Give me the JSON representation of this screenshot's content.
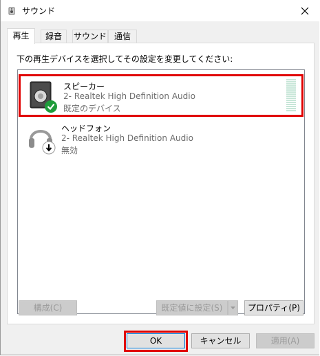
{
  "window": {
    "title": "サウンド"
  },
  "tabs": [
    {
      "label": "再生",
      "active": true
    },
    {
      "label": "録音",
      "active": false
    },
    {
      "label": "サウンド",
      "active": false
    },
    {
      "label": "通信",
      "active": false
    }
  ],
  "playback": {
    "instruction": "下の再生デバイスを選択してその設定を変更してください:",
    "devices": [
      {
        "name": "スピーカー",
        "driver": "2- Realtek High Definition Audio",
        "status": "既定のデバイス",
        "icon": "speaker-icon",
        "badge": "checkmark-icon"
      },
      {
        "name": "ヘッドフォン",
        "driver": "2- Realtek High Definition Audio",
        "status": "無効",
        "icon": "headphones-icon",
        "badge": "down-arrow-icon"
      }
    ]
  },
  "panel_buttons": {
    "configure": "構成(C)",
    "set_default": "既定値に設定(S)",
    "properties": "プロパティ(P)"
  },
  "dialog_buttons": {
    "ok": "OK",
    "cancel": "キャンセル",
    "apply": "適用(A)"
  },
  "colors": {
    "highlight": "#e00000",
    "check_badge": "#1e9c3a",
    "focus_border": "#0078d7"
  }
}
